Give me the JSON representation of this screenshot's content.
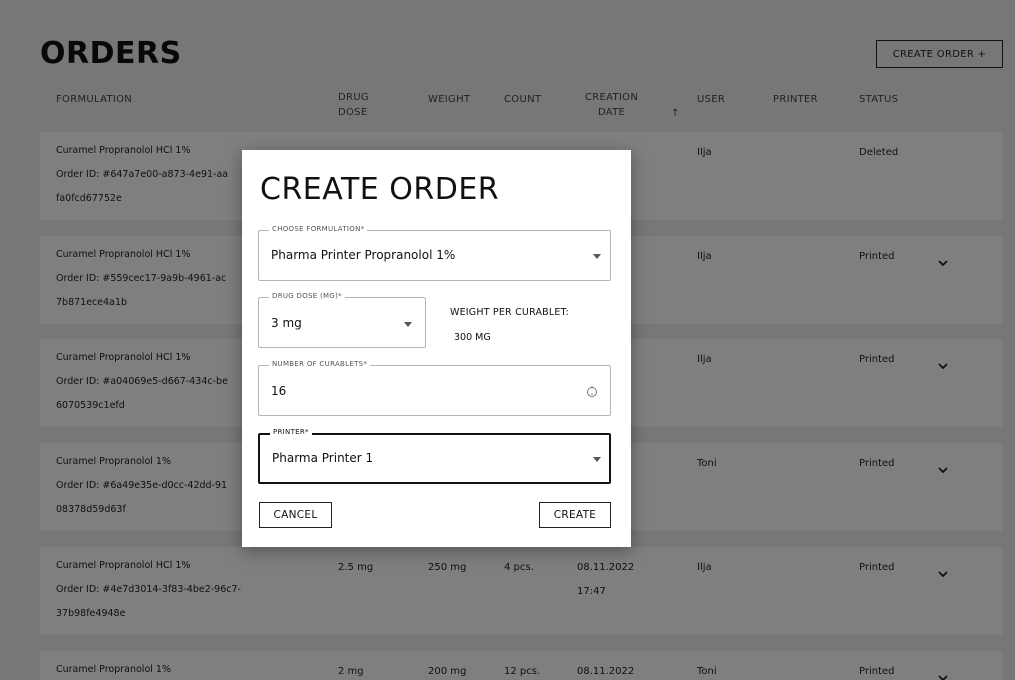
{
  "page": {
    "title": "ORDERS",
    "create_button": "CREATE ORDER +"
  },
  "table": {
    "headers": {
      "formulation": "FORMULATION",
      "drug_dose_1": "DRUG",
      "drug_dose_2": "DOSE",
      "weight": "WEIGHT",
      "count": "COUNT",
      "creation_date_1": "CREATION",
      "creation_date_2": "DATE",
      "sort_indicator": "↑",
      "user": "USER",
      "printer": "PRINTER",
      "status": "STATUS"
    },
    "rows": [
      {
        "formulation": "Curamel Propranolol HCl 1%",
        "order_id": "Order ID: #647a7e00-a873-4e91-aa",
        "order_id_tail": "fa0fcd67752e",
        "dose": "",
        "weight": "",
        "count": "",
        "date": "",
        "time": "",
        "user": "Ilja",
        "printer": "",
        "status": "Deleted",
        "expandable": false
      },
      {
        "formulation": "Curamel Propranolol HCl 1%",
        "order_id": "Order ID: #559cec17-9a9b-4961-ac",
        "order_id_tail": "7b871ece4a1b",
        "dose": "",
        "weight": "",
        "count": "",
        "date": "",
        "time": "",
        "user": "Ilja",
        "printer": "",
        "status": "Printed",
        "expandable": true
      },
      {
        "formulation": "Curamel Propranolol HCl 1%",
        "order_id": "Order ID: #a04069e5-d667-434c-be",
        "order_id_tail": "6070539c1efd",
        "dose": "",
        "weight": "",
        "count": "",
        "date": "",
        "time": "",
        "user": "Ilja",
        "printer": "",
        "status": "Printed",
        "expandable": true
      },
      {
        "formulation": "Curamel Propranolol 1%",
        "order_id": "Order ID: #6a49e35e-d0cc-42dd-91",
        "order_id_tail": "08378d59d63f",
        "dose": "",
        "weight": "",
        "count": "",
        "date": "",
        "time": "",
        "user": "Toni",
        "printer": "",
        "status": "Printed",
        "expandable": true
      },
      {
        "formulation": "Curamel Propranolol HCl 1%",
        "order_id": "Order ID: #4e7d3014-3f83-4be2-96c7-",
        "order_id_tail": "37b98fe4948e",
        "dose": "2.5 mg",
        "weight": "250 mg",
        "count": "4 pcs.",
        "date": "08.11.2022",
        "time": "17:47",
        "user": "Ilja",
        "printer": "",
        "status": "Printed",
        "expandable": true
      },
      {
        "formulation": "Curamel Propranolol 1%",
        "order_id": "",
        "order_id_tail": "",
        "dose": "2 mg",
        "weight": "200 mg",
        "count": "12 pcs.",
        "date": "08.11.2022",
        "time": "",
        "user": "Toni",
        "printer": "",
        "status": "Printed",
        "expandable": true
      }
    ]
  },
  "modal": {
    "title": "CREATE ORDER",
    "formulation_label": "CHOOSE FORMULATION*",
    "formulation_value": "Pharma Printer Propranolol 1%",
    "dose_label": "DRUG DOSE (MG)*",
    "dose_value": "3 mg",
    "weight_label": "WEIGHT PER CURABLET:",
    "weight_value": "300 MG",
    "count_label": "NUMBER OF CURABLETS*",
    "count_value": "16",
    "printer_label": "PRINTER*",
    "printer_value": "Pharma Printer 1",
    "cancel_label": "CANCEL",
    "create_label": "CREATE"
  },
  "icons": {
    "dropdown": "chevron-down-icon",
    "stepper": "stepper-icon",
    "sort": "sort-ascending-icon"
  },
  "colors": {
    "page_bg": "#eeeeec",
    "row_bg": "#ffffff",
    "overlay": "rgba(0,0,0,0.5)",
    "text": "#111111"
  }
}
